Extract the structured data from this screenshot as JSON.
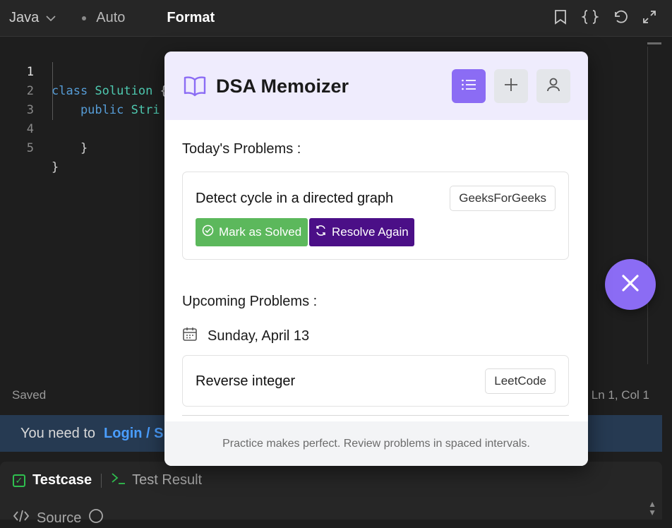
{
  "toolbar": {
    "language": "Java",
    "mode": "Auto",
    "format_label": "Format"
  },
  "editor": {
    "lines": [
      {
        "num": "1",
        "tokens": [
          {
            "t": "class ",
            "c": "kw"
          },
          {
            "t": "Solution",
            "c": "ty"
          },
          {
            "t": " {",
            "c": "pl"
          }
        ]
      },
      {
        "num": "2",
        "tokens": [
          {
            "t": "    public ",
            "c": "kw"
          },
          {
            "t": "Stri",
            "c": "ty"
          }
        ]
      },
      {
        "num": "3",
        "tokens": []
      },
      {
        "num": "4",
        "tokens": [
          {
            "t": "    }",
            "c": "pl"
          }
        ]
      },
      {
        "num": "5",
        "tokens": [
          {
            "t": "}",
            "c": "pl"
          }
        ]
      }
    ]
  },
  "status": {
    "saved": "Saved",
    "position": "Ln 1, Col 1"
  },
  "login_bar": {
    "text": "You need to",
    "link": "Login / S"
  },
  "bottom_panel": {
    "tab_testcase": "Testcase",
    "tab_result": "Test Result",
    "source": "Source"
  },
  "modal": {
    "title": "DSA Memoizer",
    "todays_title": "Today's Problems :",
    "today_problems": [
      {
        "title": "Detect cycle in a directed graph",
        "platform": "GeeksForGeeks",
        "mark_solved": "Mark as Solved",
        "resolve_again": "Resolve Again"
      }
    ],
    "upcoming_title": "Upcoming Problems :",
    "upcoming_date": "Sunday, April 13",
    "upcoming_problems": [
      {
        "title": "Reverse integer",
        "platform": "LeetCode"
      }
    ],
    "footer": "Practice makes perfect. Review problems in spaced intervals."
  },
  "colors": {
    "accent": "#8b6cf4",
    "solved_green": "#5cb85c",
    "resolve_purple": "#4b0f87",
    "header_bg": "#efecfd",
    "editor_bg": "#1e1e1e"
  },
  "icons": [
    "chevron-down-icon",
    "bookmark-icon",
    "braces-icon",
    "undo-icon",
    "expand-icon",
    "book-open-icon",
    "list-icon",
    "plus-icon",
    "user-icon",
    "check-circle-icon",
    "refresh-icon",
    "calendar-icon",
    "close-icon",
    "checkbox-icon",
    "terminal-icon",
    "code-icon",
    "help-icon"
  ]
}
